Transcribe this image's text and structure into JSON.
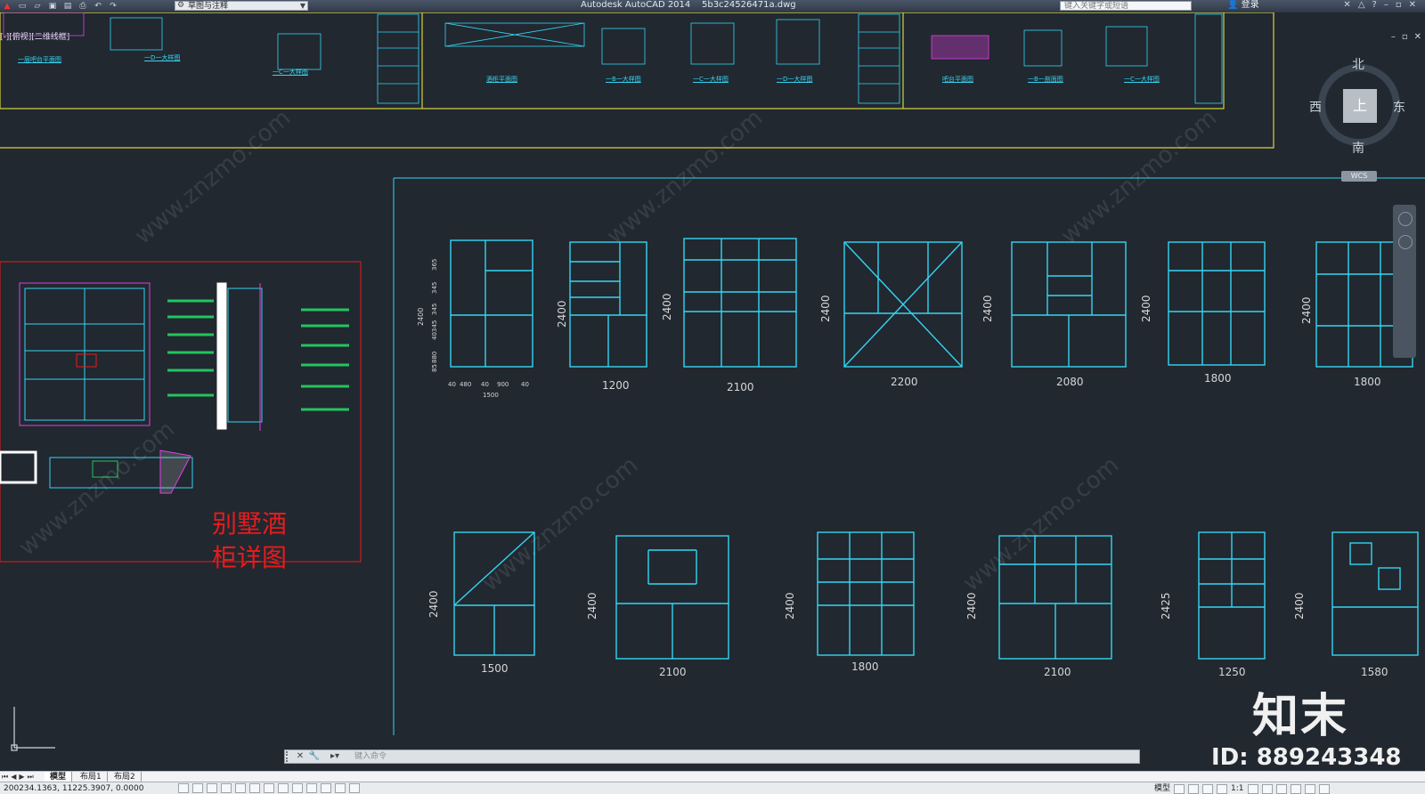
{
  "titlebar": {
    "workspace": "草图与注释",
    "app_title": "Autodesk AutoCAD 2014    5b3c24526471a.dwg",
    "search_placeholder": "键入关键字或短语",
    "login": "登录"
  },
  "viewport": {
    "label": "[-][俯视][二维线框]"
  },
  "viewcube": {
    "top": "上",
    "north": "北",
    "south": "南",
    "east": "东",
    "west": "西",
    "wcs": "WCS"
  },
  "top_sheet": {
    "labels": [
      "一层吧台平面图",
      "一D一大样图",
      "一C一大样图",
      "酒柜平面图",
      "一B一大样图",
      "一C一大样图",
      "一D一大样图",
      "吧台平面图",
      "一B一剖面图",
      "一C一大样图"
    ]
  },
  "detail_sheet": {
    "title_line1": "别墅酒",
    "title_line2": "柜详图"
  },
  "cabinets_row1": {
    "first_widths": [
      "40",
      "480",
      "40",
      "900",
      "40"
    ],
    "first_total": "1500",
    "first_heights": [
      "2400",
      "365",
      "345",
      "345",
      "40345",
      "880",
      "85"
    ],
    "heights": [
      "2400",
      "2400",
      "2400",
      "2400",
      "2400",
      "2400"
    ],
    "widths": [
      "1200",
      "2100",
      "2200",
      "2080",
      "1800",
      "1800"
    ]
  },
  "cabinets_row2": {
    "heights": [
      "2400",
      "2400",
      "2400",
      "2400",
      "2425",
      "2400"
    ],
    "widths": [
      "1500",
      "2100",
      "1800",
      "2100",
      "1250",
      "1580"
    ]
  },
  "cmdline": {
    "placeholder": "键入命令"
  },
  "layout_tabs": [
    "模型",
    "布局1",
    "布局2"
  ],
  "status": {
    "coords": "200234.1363, 11225.3907, 0.0000",
    "model_label": "模型",
    "scale": "1:1"
  },
  "watermark": {
    "site": "www.znzmo.com",
    "brand": "知末",
    "id": "ID: 889243348"
  },
  "colors": {
    "background": "#212830",
    "cyan": "#35d5f2",
    "red": "#e81b1b",
    "yellow_frame": "#d8d23a",
    "magenta": "#e040e0",
    "green": "#22c55e"
  }
}
